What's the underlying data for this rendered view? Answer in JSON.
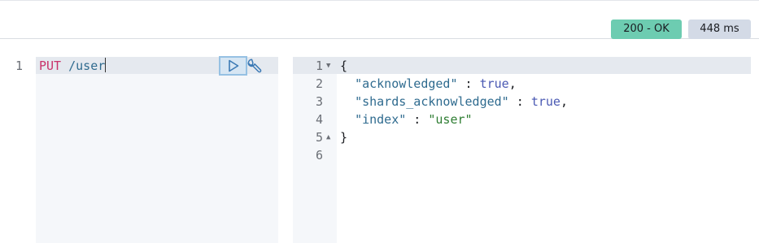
{
  "status": {
    "code_label": "200 - OK",
    "code_color": "#6dccb1",
    "time_label": "448 ms"
  },
  "request": {
    "line_numbers": [
      "1"
    ],
    "method": "PUT",
    "path": "/user"
  },
  "toolbar": {
    "run_icon": "play-icon",
    "settings_icon": "wrench-icon"
  },
  "response": {
    "line_numbers": [
      "1",
      "2",
      "3",
      "4",
      "5",
      "6"
    ],
    "open_brace": "{",
    "close_brace": "}",
    "entries": [
      {
        "key": "\"acknowledged\"",
        "sep": " : ",
        "value": "true",
        "trail": ","
      },
      {
        "key": "\"shards_acknowledged\"",
        "sep": " : ",
        "value": "true",
        "trail": ","
      },
      {
        "key": "\"index\"",
        "sep": " : ",
        "value": "\"user\"",
        "trail": ""
      }
    ]
  }
}
